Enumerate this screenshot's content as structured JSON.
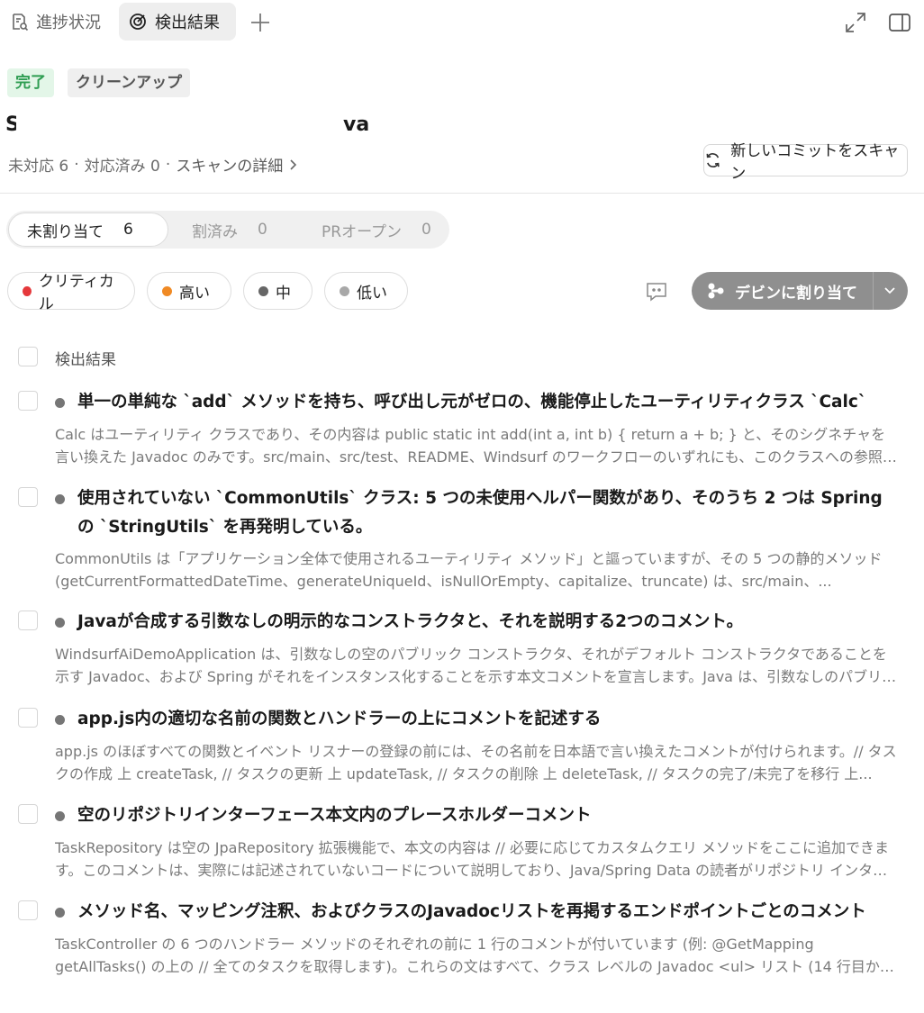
{
  "tabs": [
    {
      "label": "進捗状況",
      "icon": "progress-doc-icon"
    },
    {
      "label": "検出結果",
      "icon": "target-icon"
    }
  ],
  "badges": {
    "status": "完了",
    "category": "クリーンアップ"
  },
  "repo": {
    "title_start": "S",
    "title_end": "va"
  },
  "meta": {
    "unresolved": "未対応 6",
    "resolved": "対応済み 0",
    "details_link": "スキャンの詳細"
  },
  "scan_button": {
    "label": "新しいコミットをスキャン"
  },
  "segments": [
    {
      "label": "未割り当て",
      "count": "6"
    },
    {
      "label": "割済み",
      "count": "0"
    },
    {
      "label": "PRオープン",
      "count": "0"
    }
  ],
  "filters": [
    {
      "label": "クリティカル",
      "color": "#e5383b"
    },
    {
      "label": "高い",
      "color": "#f08a24"
    },
    {
      "label": "中",
      "color": "#666666"
    },
    {
      "label": "低い",
      "color": "#a8a8a8"
    }
  ],
  "assign_button": {
    "label": "デビンに割り当て"
  },
  "list_header": "検出結果",
  "findings": [
    {
      "title": "単一の単純な `add` メソッドを持ち、呼び出し元がゼロの、機能停止したユーティリティクラス `Calc`",
      "description": "Calc はユーティリティ クラスであり、その内容は public static int add(int a, int b) { return a + b; } と、そのシグネチャを言い換えた Javadoc のみです。src/main、src/test、README、Windsurf のワークフローのいずれにも、このクラスへの参照はありませ..."
    },
    {
      "title": "使用されていない `CommonUtils` クラス: 5 つの未使用ヘルパー関数があり、そのうち 2 つは Spring の `StringUtils` を再発明している。",
      "description": "CommonUtils は「アプリケーション全体で使用されるユーティリティ メソッド」と謳っていますが、その 5 つの静的メソッド (getCurrentFormattedDateTime、generateUniqueId、isNullOrEmpty、capitalize、truncate) は、src/main、..."
    },
    {
      "title": "Javaが合成する引数なしの明示的なコンストラクタと、それを説明する2つのコメント。",
      "description": "WindsurfAiDemoApplication は、引数なしの空のパブリック コンストラクタ、それがデフォルト コンストラクタであることを示す Javadoc、および Spring がそれをインスタンス化することを示す本文コメントを宣言します。Java は、引数なしのパブリック コンス..."
    },
    {
      "title": "app.js内の適切な名前の関数とハンドラーの上にコメントを記述する",
      "description": "app.js のほぼすべての関数とイベント リスナーの登録の前には、その名前を日本語で言い換えたコメントが付けられます。// タスクの作成 上 createTask, // タスクの更新 上 updateTask, // タスクの削除 上 deleteTask, // タスクの完了/未完了を移行 上..."
    },
    {
      "title": "空のリポジトリインターフェース本文内のプレースホルダーコメント",
      "description": "TaskRepository は空の JpaRepository 拡張機能で、本文の内容は // 必要に応じてカスタムクエリ メソッドをここに追加できます。このコメントは、実際には記述されていないコードについて説明しており、Java/Spring Data の読者がリポジトリ インターフェース..."
    },
    {
      "title": "メソッド名、マッピング注釈、およびクラスのJavadocリストを再掲するエンドポイントごとのコメント",
      "description": "TaskController の 6 つのハンドラー メソッドのそれぞれの前に 1 行のコメントが付いています (例: @GetMapping getAllTasks() の上の // 全てのタスクを取得します)。これらの文はすべて、クラス レベルの Javadoc <ul> リスト (14 行目から 19 行目) にすで..."
    }
  ]
}
